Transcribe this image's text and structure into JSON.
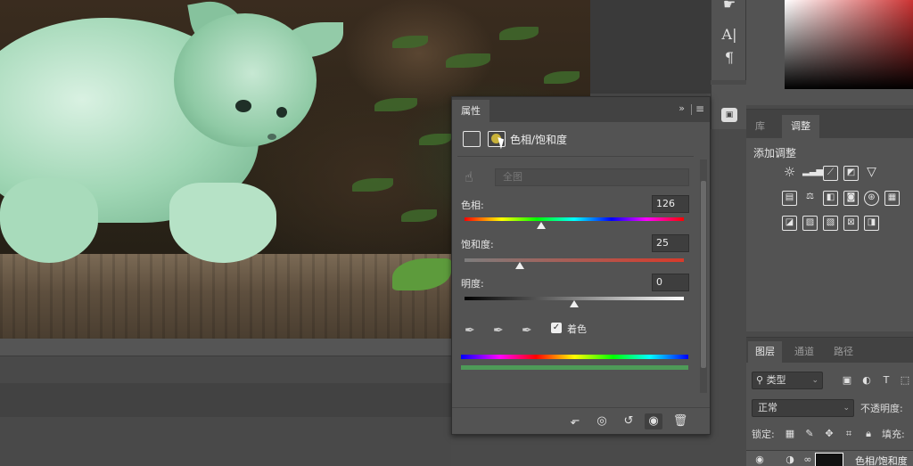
{
  "properties_panel": {
    "tab_label": "属性",
    "collapse_label": "»",
    "menu_label": "≡",
    "adjustment_type": "色相/饱和度",
    "preset_value": "全图",
    "hue": {
      "label": "色相:",
      "value": "126",
      "fraction": 0.35
    },
    "saturation": {
      "label": "饱和度:",
      "value": "25",
      "fraction": 0.25
    },
    "lightness": {
      "label": "明度:",
      "value": "0",
      "fraction": 0.5
    },
    "colorize_label": "着色",
    "colorize_checked": true
  },
  "adjustments_panel": {
    "tabs": [
      "库",
      "调整"
    ],
    "title": "添加调整"
  },
  "layers_panel": {
    "tabs": [
      "图层",
      "通道",
      "路径"
    ],
    "filter_label": "类型",
    "blend_mode": "正常",
    "opacity_label": "不透明度:",
    "lock_label": "锁定:",
    "fill_label": "填充:",
    "layer_name": "色相/饱和度"
  },
  "tool_strip": {
    "items": [
      "A|",
      "¶"
    ]
  },
  "colors": {
    "panel_bg": "#535353",
    "header_bg": "#424242",
    "colorize_green": "#4e9a58"
  }
}
